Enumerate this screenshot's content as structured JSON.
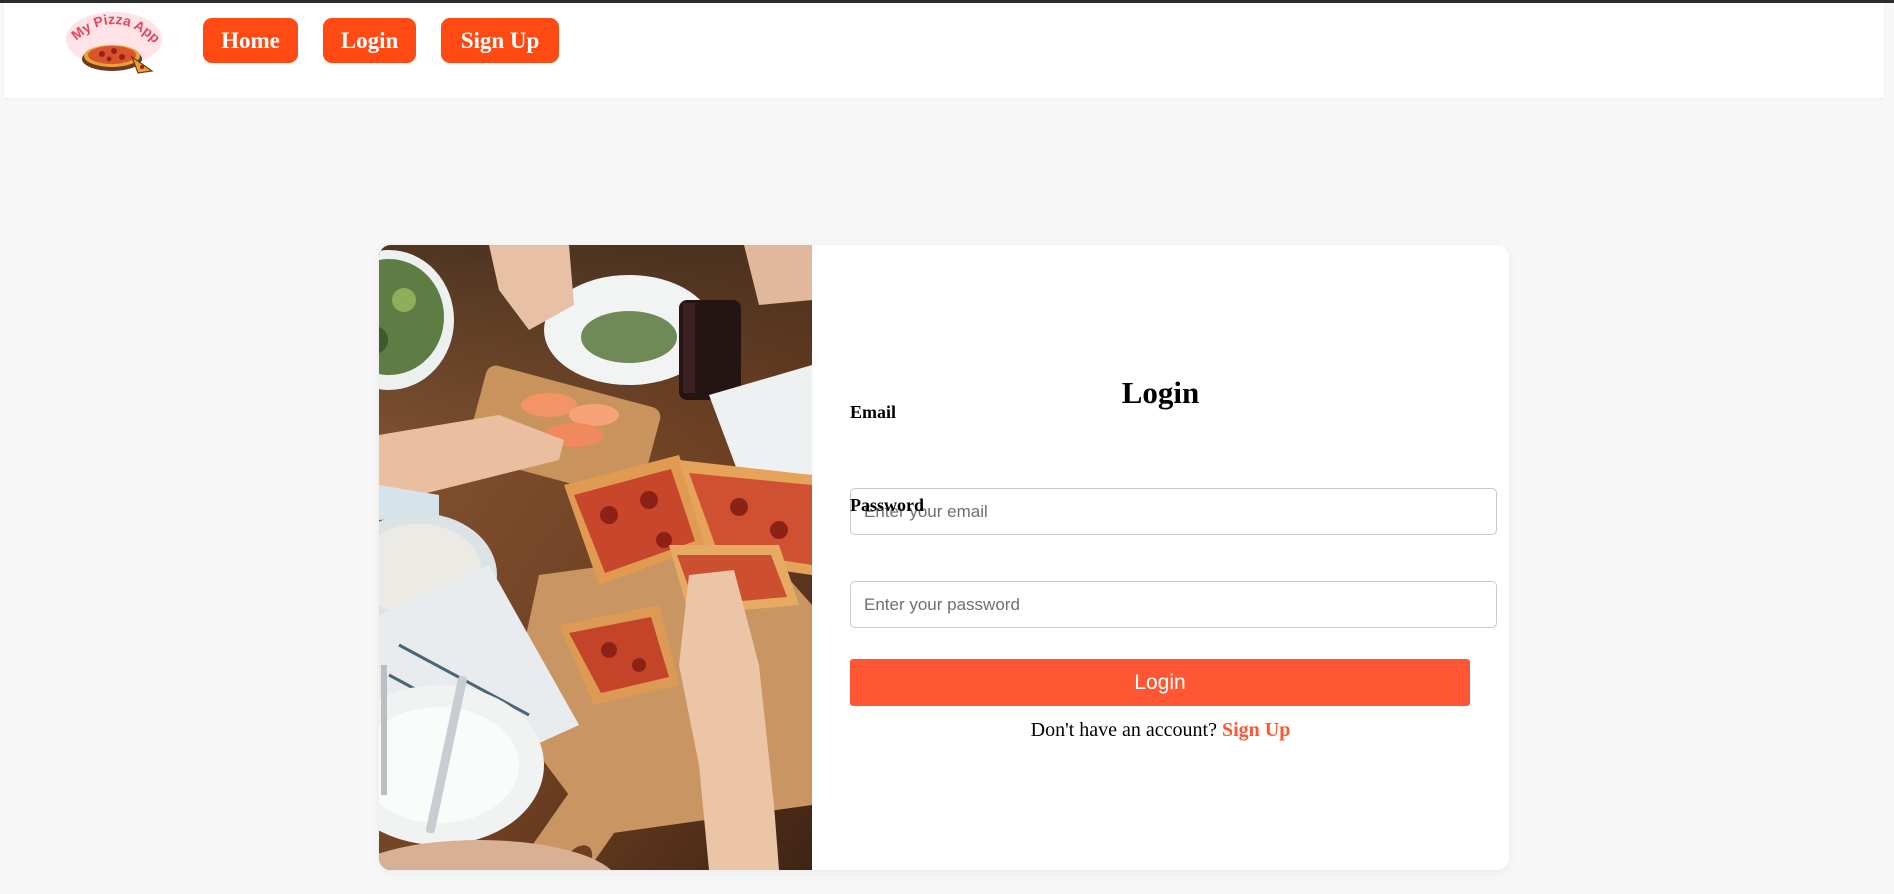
{
  "brand": {
    "logo_alt": "My Pizza App",
    "logo_text": "My Pizza App",
    "accent_color": "#ff4a14"
  },
  "nav": {
    "items": [
      {
        "label": "Home"
      },
      {
        "label": "Login"
      },
      {
        "label": "Sign Up"
      }
    ]
  },
  "hero_image": {
    "alt": "Friends sharing pizza on a wooden board"
  },
  "form": {
    "title": "Login",
    "email": {
      "label": "Email",
      "placeholder": "Enter your email",
      "value": ""
    },
    "password": {
      "label": "Password",
      "placeholder": "Enter your password",
      "value": ""
    },
    "submit_label": "Login",
    "submit_color": "#ff5733",
    "signup_prompt": "Don't have an account?",
    "signup_link": "Sign Up"
  }
}
